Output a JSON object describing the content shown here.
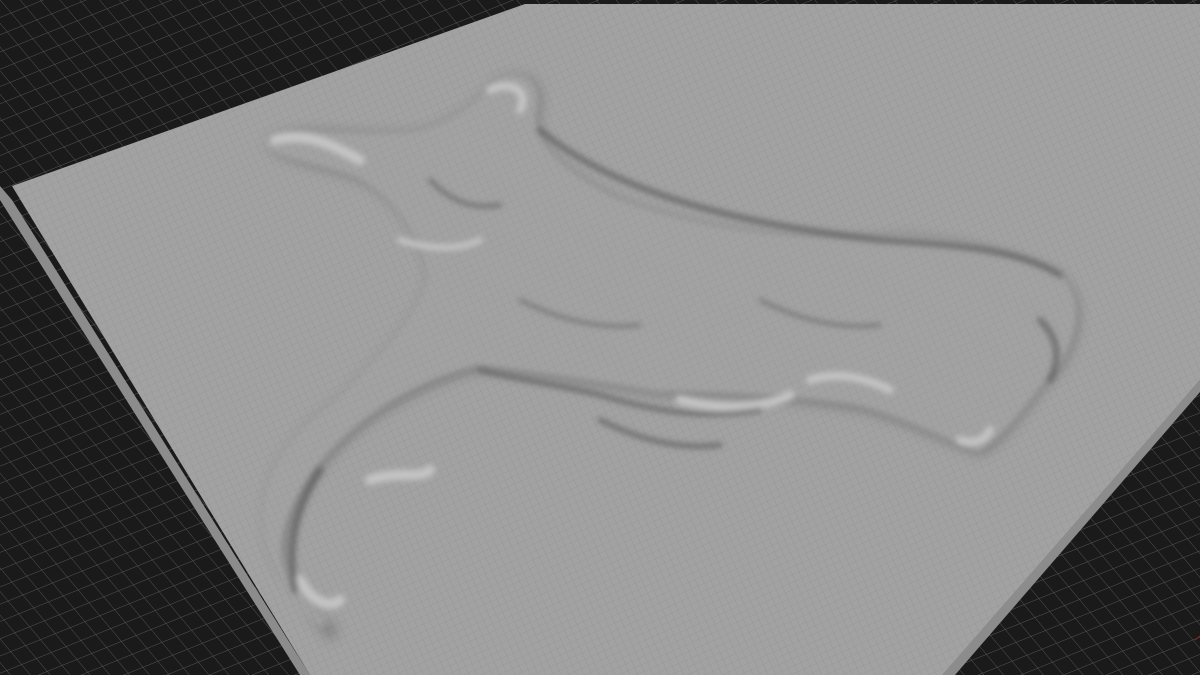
{
  "viewport": {
    "background_color": "#1a1a1a",
    "ground_grid_line_color": "#8a8a8a",
    "plate_color": "#a2a2a2",
    "plate_wire_color": "#7f7f7f",
    "plate_side_color": "#8c8c8c",
    "relief_highlight_color": "#c4c4c4",
    "relief_shadow_color": "#5a5a5a",
    "axis_hint_color": "#8a2a2a"
  },
  "scene": {
    "object": "wireframe-displaced-plane",
    "relief_shape": "cross-shaped-terrain-relief",
    "view": "perspective"
  }
}
